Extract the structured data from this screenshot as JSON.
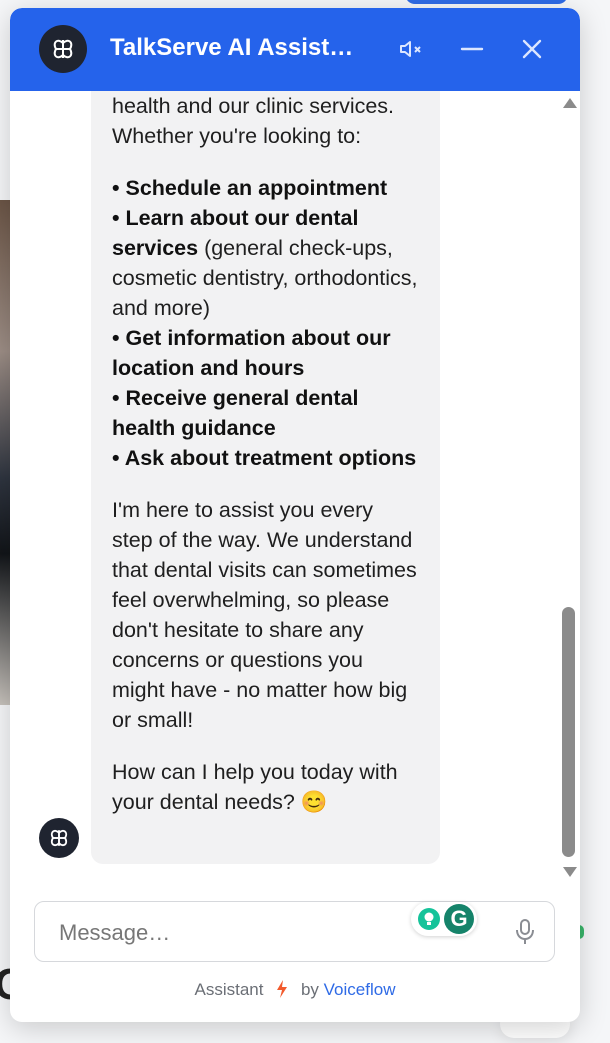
{
  "header": {
    "title": "TalkServe AI Assist…"
  },
  "message": {
    "intro": "health and our clinic services. Whether you're looking to:",
    "bullets": [
      {
        "bold": "• Schedule an appointment",
        "rest": ""
      },
      {
        "bold": "• Learn about our dental services",
        "rest": " (general check-ups, cosmetic dentistry, orthodontics, and more)"
      },
      {
        "bold": "• Get information about our location and hours",
        "rest": ""
      },
      {
        "bold": "• Receive general dental health guidance",
        "rest": ""
      },
      {
        "bold": "• Ask about treatment options",
        "rest": ""
      }
    ],
    "paragraph": "I'm here to assist you every step of the way. We understand that dental visits can sometimes feel overwhelming, so please don't hesitate to share any concerns or questions you might have - no matter how big or small!",
    "closing": "How can I help you today with your dental needs?",
    "emoji": "😊"
  },
  "composer": {
    "placeholder": "Message…",
    "grammarly_letter": "G"
  },
  "footer": {
    "prefix": "Assistant",
    "by": "by",
    "brand": "Voiceflow"
  },
  "colors": {
    "header": "#2563eb",
    "bubble": "#f2f2f3",
    "link": "#2f6be6",
    "bolt": "#f25a2c"
  },
  "icons": [
    "bot-logo-icon",
    "mute-icon",
    "minimize-icon",
    "close-icon",
    "microphone-icon",
    "grammarly-icon",
    "bolt-icon"
  ]
}
